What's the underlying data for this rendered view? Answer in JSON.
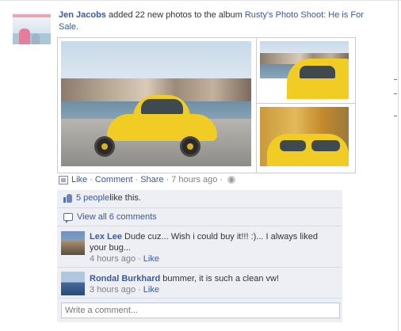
{
  "story": {
    "actor": "Jen Jacobs",
    "action": " added 22 new photos to the album ",
    "album": "Rusty's Photo Shoot: He is For Sale."
  },
  "actions": {
    "like": "Like",
    "comment": "Comment",
    "share": "Share",
    "timestamp": "7 hours ago"
  },
  "likes": {
    "count_link": "5 people",
    "suffix": " like this."
  },
  "view_all": "View all 6 comments",
  "comments": [
    {
      "author": "Lex Lee",
      "text": " Dude cuz... Wish i could buy it!!! :)... I always liked your bug...",
      "time": "4 hours ago",
      "like": "Like"
    },
    {
      "author": "Rondal Burkhard",
      "text": " bummer, it is such a clean vw!",
      "time": "3 hours ago",
      "like": "Like"
    }
  ],
  "composer": {
    "placeholder": "Write a comment..."
  },
  "icons": {
    "album": "photo-album-icon",
    "privacy": "globe-icon",
    "like": "thumbs-up-icon",
    "comments": "comment-bubble-icon"
  },
  "colors": {
    "link": "#3b5998",
    "ufi_background": "#edeff4",
    "muted": "#808080"
  }
}
